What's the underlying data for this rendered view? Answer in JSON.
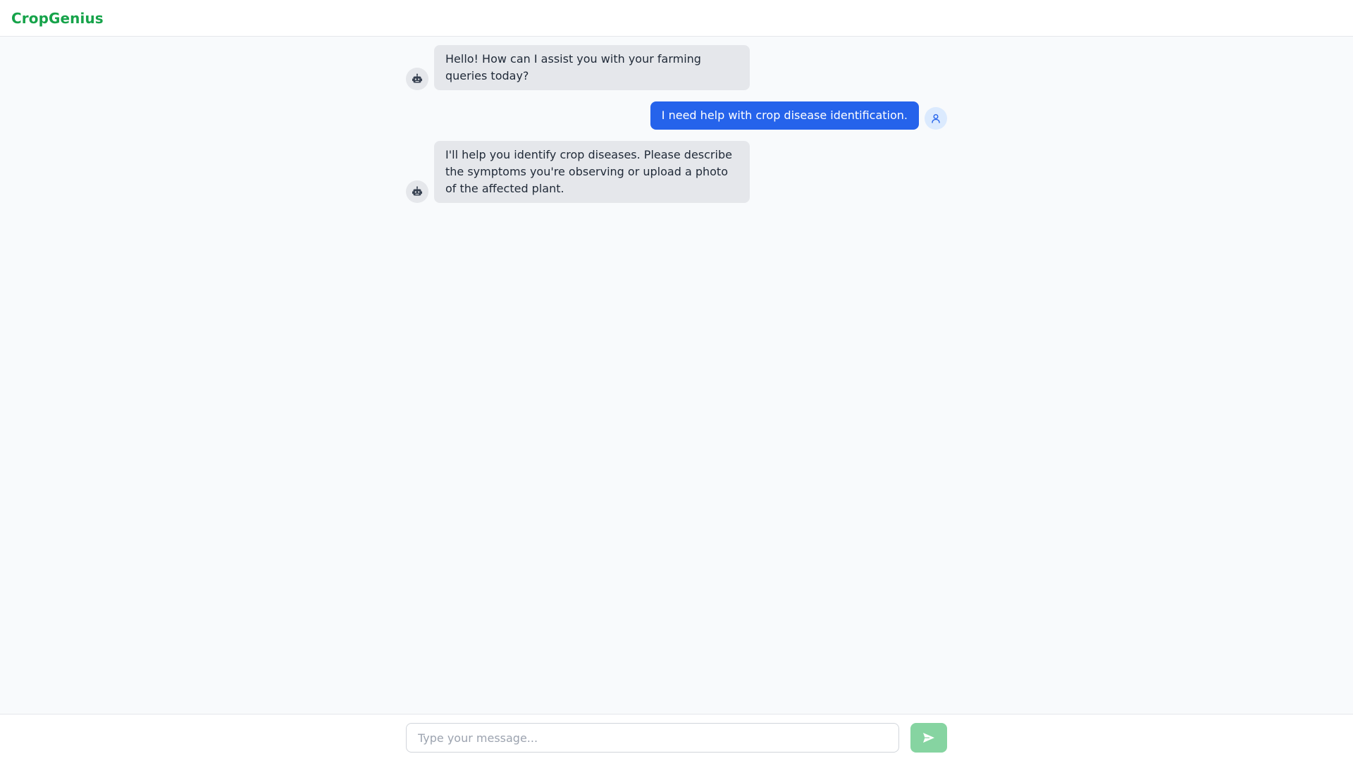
{
  "app": {
    "title": "CropGenius",
    "brand_color": "#16a34a"
  },
  "messages": [
    {
      "role": "bot",
      "text": "Hello! How can I assist you with your farming queries today?",
      "avatar_icon": "robot-icon"
    },
    {
      "role": "user",
      "text": "I need help with crop disease identification.",
      "avatar_icon": "user-icon"
    },
    {
      "role": "bot",
      "text": "I'll help you identify crop diseases. Please describe the symptoms you're observing or upload a photo of the affected plant.",
      "avatar_icon": "robot-icon"
    }
  ],
  "composer": {
    "placeholder": "Type your message...",
    "value": "",
    "send_icon": "send-icon",
    "send_color": "#86d4a1"
  },
  "colors": {
    "user_bubble": "#2563eb",
    "bot_bubble": "#e5e7eb",
    "background": "#f8fafc"
  }
}
